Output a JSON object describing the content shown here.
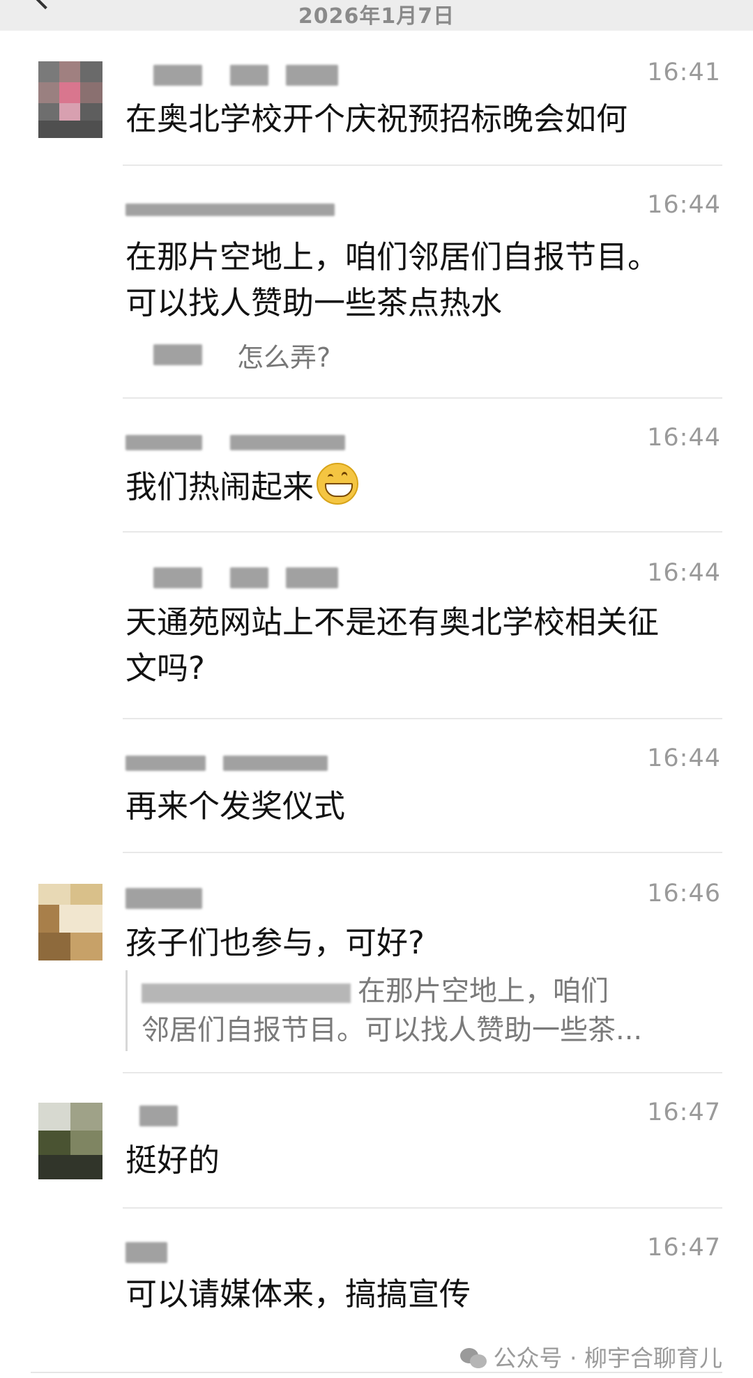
{
  "header": {
    "date": "2026年1月7日"
  },
  "messages": [
    {
      "time": "16:41",
      "text": "在奥北学校开个庆祝预招标晚会如何"
    },
    {
      "time": "16:44",
      "text": "在那片空地上，咱们邻居们自报节目。\n可以找人赞助一些茶点热水",
      "reply": "怎么弄?"
    },
    {
      "time": "16:44",
      "text": "我们热闹起来"
    },
    {
      "time": "16:44",
      "text": "天通苑网站上不是还有奥北学校相关征\n文吗?"
    },
    {
      "time": "16:44",
      "text": "再来个发奖仪式"
    },
    {
      "time": "16:46",
      "text": "孩子们也参与，可好?",
      "quote_line1": "在那片空地上，咱们",
      "quote_line2": "邻居们自报节目。可以找人赞助一些茶..."
    },
    {
      "time": "16:47",
      "text": "挺好的"
    },
    {
      "time": "16:47",
      "text": "可以请媒体来，搞搞宣传"
    }
  ],
  "footer": {
    "source": "公众号 · 柳宇合聊育儿"
  },
  "colors": {
    "topbar": "#ededed",
    "time": "#9a9a9a",
    "text": "#121212",
    "divider": "#e8e8e8"
  },
  "icons": {
    "emoji": "grinning-face-icon",
    "footer": "wechat-icon"
  }
}
